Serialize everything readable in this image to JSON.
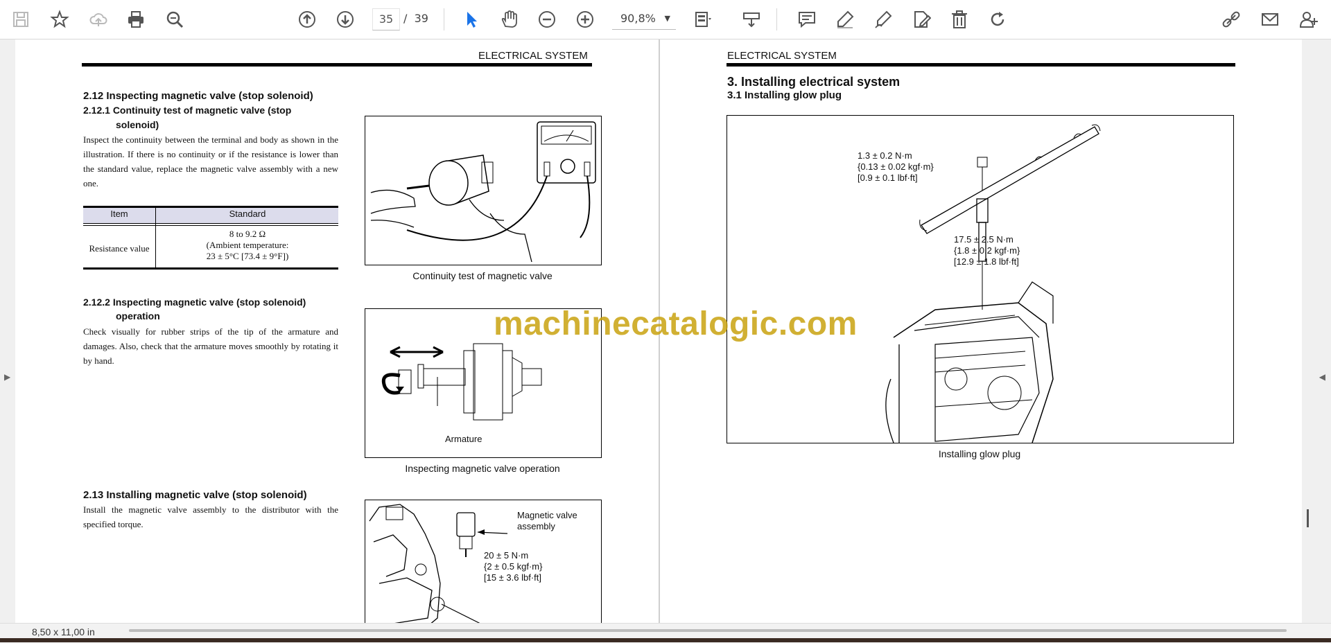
{
  "toolbar": {
    "page_current": "35",
    "page_separator": "/",
    "page_total": "39",
    "zoom": "90,8%",
    "zoom_caret": "▼"
  },
  "status": {
    "page_size": "8,50 x 11,00 in"
  },
  "watermark": "machinecatalogic.com",
  "left_page": {
    "header": "ELECTRICAL SYSTEM",
    "sec_212": "2.12 Inspecting magnetic valve (stop solenoid)",
    "sec_2121_a": "2.12.1 Continuity test of magnetic valve (stop",
    "sec_2121_b": "solenoid)",
    "body_2121": "Inspect the continuity between the terminal and body as shown in the illustration. If there is no continuity or if the resistance is lower than the standard value, replace the magnetic valve assembly with a new one.",
    "table": {
      "col_item": "Item",
      "col_standard": "Standard",
      "row_label": "Resistance value",
      "row_v1": "8 to 9.2 Ω",
      "row_v2": "(Ambient temperature:",
      "row_v3": "23 ± 5°C [73.4 ± 9°F])"
    },
    "fig1_caption": "Continuity test of magnetic valve",
    "sec_2122_a": "2.12.2 Inspecting magnetic valve (stop solenoid)",
    "sec_2122_b": "operation",
    "body_2122": "Check visually for rubber strips of the tip of the armature and damages. Also, check that the armature moves smoothly by rotating it by hand.",
    "fig2_label": "Armature",
    "fig2_caption": "Inspecting magnetic valve operation",
    "sec_213": "2.13 Installing magnetic valve (stop solenoid)",
    "body_213": "Install the magnetic valve assembly to the distributor with the specified torque.",
    "fig3_label1": "Magnetic valve",
    "fig3_label2": "assembly",
    "fig3_t1": "20 ± 5 N·m",
    "fig3_t2": "{2 ± 0.5 kgf·m}",
    "fig3_t3": "[15 ± 3.6 lbf·ft]"
  },
  "right_page": {
    "header": "ELECTRICAL SYSTEM",
    "sec_3": "3. Installing electrical system",
    "sec_31": "3.1   Installing glow plug",
    "tq1_a": "1.3 ± 0.2 N·m",
    "tq1_b": "{0.13 ± 0.02 kgf·m}",
    "tq1_c": "[0.9 ± 0.1 lbf·ft]",
    "tq2_a": "17.5 ± 2.5 N·m",
    "tq2_b": "{1.8 ± 0.2 kgf·m}",
    "tq2_c": "[12.9 ± 1.8 lbf·ft]",
    "fig_caption": "Installing glow plug"
  }
}
